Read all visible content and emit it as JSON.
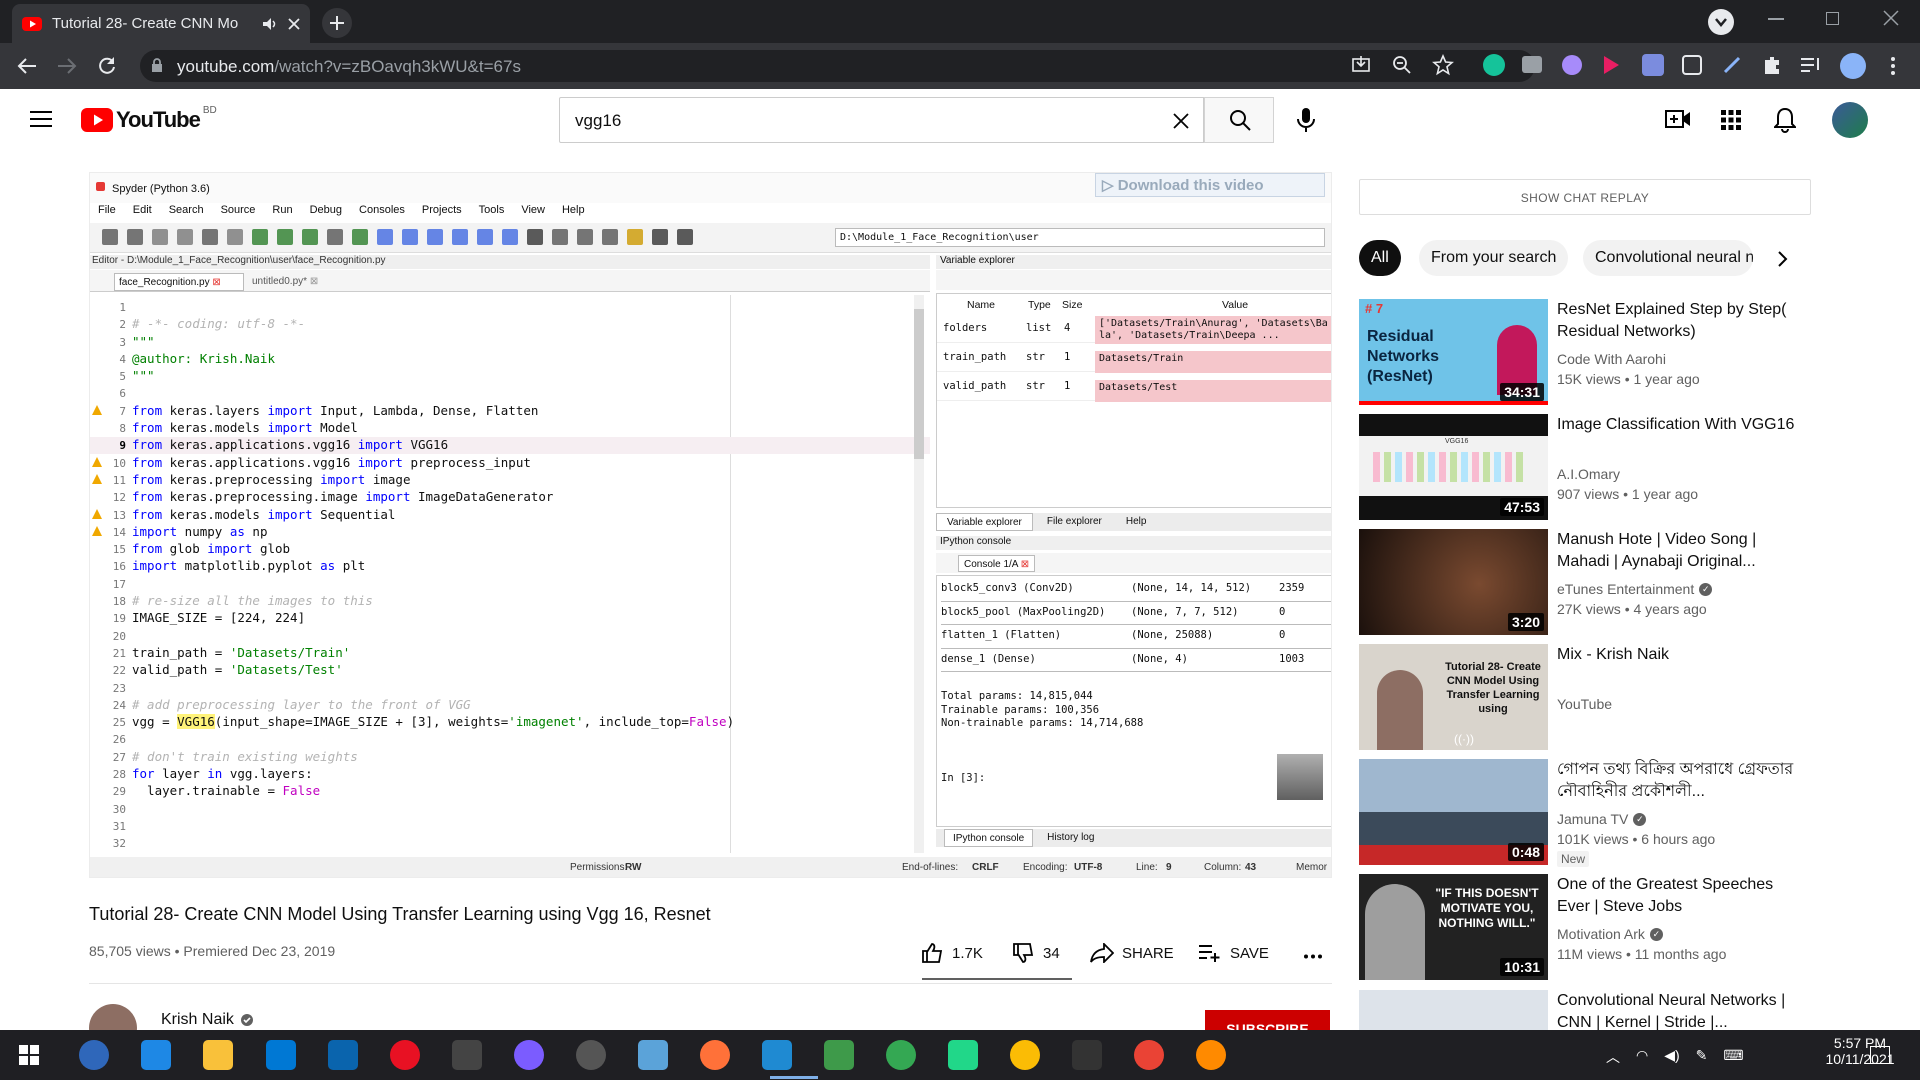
{
  "browser": {
    "tab_title": "Tutorial 28- Create CNN Mo",
    "url_host": "youtube.com",
    "url_path": "/watch?v=zBOavqh3kWU&t=67s"
  },
  "youtube": {
    "logo_text": "YouTube",
    "region": "BD",
    "search_value": "vgg16"
  },
  "video_frame": {
    "window_title": "Spyder (Python 3.6)",
    "menu": [
      "File",
      "Edit",
      "Search",
      "Source",
      "Run",
      "Debug",
      "Consoles",
      "Projects",
      "Tools",
      "View",
      "Help"
    ],
    "path_box": "D:\\Module_1_Face_Recognition\\user",
    "download_overlay": "Download this video",
    "editor_title": "Editor - D:\\Module_1_Face_Recognition\\user\\face_Recognition.py",
    "file_tabs": [
      "face_Recognition.py",
      "untitled0.py*"
    ],
    "code_lines": [
      {
        "n": "1",
        "t": ""
      },
      {
        "n": "2",
        "t": "# -*- coding: utf-8 -*-",
        "c": "cm"
      },
      {
        "n": "3",
        "t": "\"\"\"",
        "c": "str"
      },
      {
        "n": "4",
        "t": "@author: Krish.Naik",
        "c": "str"
      },
      {
        "n": "5",
        "t": "\"\"\"",
        "c": "str"
      },
      {
        "n": "6",
        "t": ""
      },
      {
        "n": "7",
        "t": "from keras.layers import Input, Lambda, Dense, Flatten",
        "w": true
      },
      {
        "n": "8",
        "t": "from keras.models import Model"
      },
      {
        "n": "9",
        "t": "from keras.applications.vgg16 import VGG16"
      },
      {
        "n": "10",
        "t": "from keras.applications.vgg16 import preprocess_input",
        "w": true
      },
      {
        "n": "11",
        "t": "from keras.preprocessing import image",
        "w": true
      },
      {
        "n": "12",
        "t": "from keras.preprocessing.image import ImageDataGenerator"
      },
      {
        "n": "13",
        "t": "from keras.models import Sequential",
        "w": true
      },
      {
        "n": "14",
        "t": "import numpy as np",
        "w": true
      },
      {
        "n": "15",
        "t": "from glob import glob"
      },
      {
        "n": "16",
        "t": "import matplotlib.pyplot as plt"
      },
      {
        "n": "17",
        "t": ""
      },
      {
        "n": "18",
        "t": "# re-size all the images to this",
        "c": "cm"
      },
      {
        "n": "19",
        "t": "IMAGE_SIZE = [224, 224]"
      },
      {
        "n": "20",
        "t": ""
      },
      {
        "n": "21",
        "t": "train_path = 'Datasets/Train'"
      },
      {
        "n": "22",
        "t": "valid_path = 'Datasets/Test'"
      },
      {
        "n": "23",
        "t": ""
      },
      {
        "n": "24",
        "t": "# add preprocessing layer to the front of VGG",
        "c": "cm"
      },
      {
        "n": "25",
        "t": "vgg = VGG16(input_shape=IMAGE_SIZE + [3], weights='imagenet', include_top=False)"
      },
      {
        "n": "26",
        "t": ""
      },
      {
        "n": "27",
        "t": "# don't train existing weights",
        "c": "cm"
      },
      {
        "n": "28",
        "t": "for layer in vgg.layers:"
      },
      {
        "n": "29",
        "t": "  layer.trainable = False"
      },
      {
        "n": "30",
        "t": ""
      },
      {
        "n": "31",
        "t": ""
      },
      {
        "n": "32",
        "t": ""
      }
    ],
    "var_explorer": {
      "title": "Variable explorer",
      "headers": [
        "Name",
        "Type",
        "Size",
        "Value"
      ],
      "rows": [
        {
          "name": "folders",
          "type": "list",
          "size": "4",
          "value": "['Datasets/Train\\Anurag', 'Datasets\\Bala', 'Datasets/Train\\Deepa ..."
        },
        {
          "name": "train_path",
          "type": "str",
          "size": "1",
          "value": "Datasets/Train"
        },
        {
          "name": "valid_path",
          "type": "str",
          "size": "1",
          "value": "Datasets/Test"
        }
      ]
    },
    "pane_tabs": [
      "Variable explorer",
      "File explorer",
      "Help"
    ],
    "console_title": "IPython console",
    "console_tab": "Console 1/A",
    "console_rows": [
      {
        "layer": "block5_conv3 (Conv2D)",
        "shape": "(None, 14, 14, 512)",
        "params": "2359"
      },
      {
        "layer": "block5_pool (MaxPooling2D)",
        "shape": "(None, 7, 7, 512)",
        "params": "0"
      },
      {
        "layer": "flatten_1 (Flatten)",
        "shape": "(None, 25088)",
        "params": "0"
      },
      {
        "layer": "dense_1 (Dense)",
        "shape": "(None, 4)",
        "params": "1003"
      }
    ],
    "console_summary": [
      "Total params: 14,815,044",
      "Trainable params: 100,356",
      "Non-trainable params: 14,714,688"
    ],
    "console_prompt": "In [3]:",
    "console_bottom_tabs": [
      "IPython console",
      "History log"
    ],
    "statusbar": {
      "perm_label": "Permissions:",
      "perm": "RW",
      "eol_label": "End-of-lines:",
      "eol": "CRLF",
      "enc_label": "Encoding:",
      "enc": "UTF-8",
      "line_label": "Line:",
      "line": "9",
      "col_label": "Column:",
      "col": "43",
      "mem": "Memor"
    }
  },
  "video_info": {
    "title": "Tutorial 28- Create CNN Model Using Transfer Learning using Vgg 16, Resnet",
    "views": "85,705 views",
    "premiered": "Premiered Dec 23, 2019",
    "likes": "1.7K",
    "dislikes": "34",
    "share": "SHARE",
    "save": "SAVE",
    "channel": "Krish Naik",
    "subscribe": "SUBSCRIBE"
  },
  "sidebar": {
    "chat_replay": "SHOW CHAT REPLAY",
    "chips": [
      "All",
      "From your search",
      "Convolutional neural n"
    ],
    "recs": [
      {
        "title": "ResNet Explained Step by Step( Residual Networks)",
        "channel": "Code With Aarohi",
        "meta": "15K views • 1 year ago",
        "duration": "34:31",
        "thumb_text": "Residual Networks (ResNet)",
        "rank": "# 7"
      },
      {
        "title": "Image Classification With VGG16",
        "channel": "A.I.Omary",
        "meta": "907 views • 1 year ago",
        "duration": "47:53",
        "thumb_text": "VGG16"
      },
      {
        "title": "Manush Hote | Video Song | Mahadi | Aynabaji Original...",
        "channel": "eTunes Entertainment",
        "meta": "27K views • 4 years ago",
        "duration": "3:20",
        "verified": true
      },
      {
        "title": "Mix - Krish Naik",
        "channel": "YouTube",
        "meta": "",
        "duration": "",
        "thumb_text": "Tutorial 28- Create CNN Model Using Transfer Learning using"
      },
      {
        "title": "গোপন তথ্য বিক্রির অপরাধে গ্রেফতার নৌবাহিনীর প্রকৌশলী...",
        "channel": "Jamuna TV",
        "meta": "101K views • 6 hours ago",
        "duration": "0:48",
        "badge": "New",
        "verified": true
      },
      {
        "title": "One of the Greatest Speeches Ever | Steve Jobs",
        "channel": "Motivation Ark",
        "meta": "11M views • 11 months ago",
        "duration": "10:31",
        "thumb_text": "\"IF THIS DOESN'T MOTIVATE YOU, NOTHING WILL.\"",
        "verified": true
      },
      {
        "title": "Convolutional Neural Networks | CNN | Kernel | Stride |...",
        "channel": "",
        "meta": "",
        "duration": ""
      }
    ]
  },
  "taskbar": {
    "time": "5:57 PM",
    "date": "10/11/2021"
  },
  "colors": {
    "yt_red": "#ff0000",
    "chrome_dark": "#202124",
    "chrome_toolbar": "#35363a",
    "spyder_blue": "#0000ff",
    "var_row_pink": "#f5c6cb"
  }
}
